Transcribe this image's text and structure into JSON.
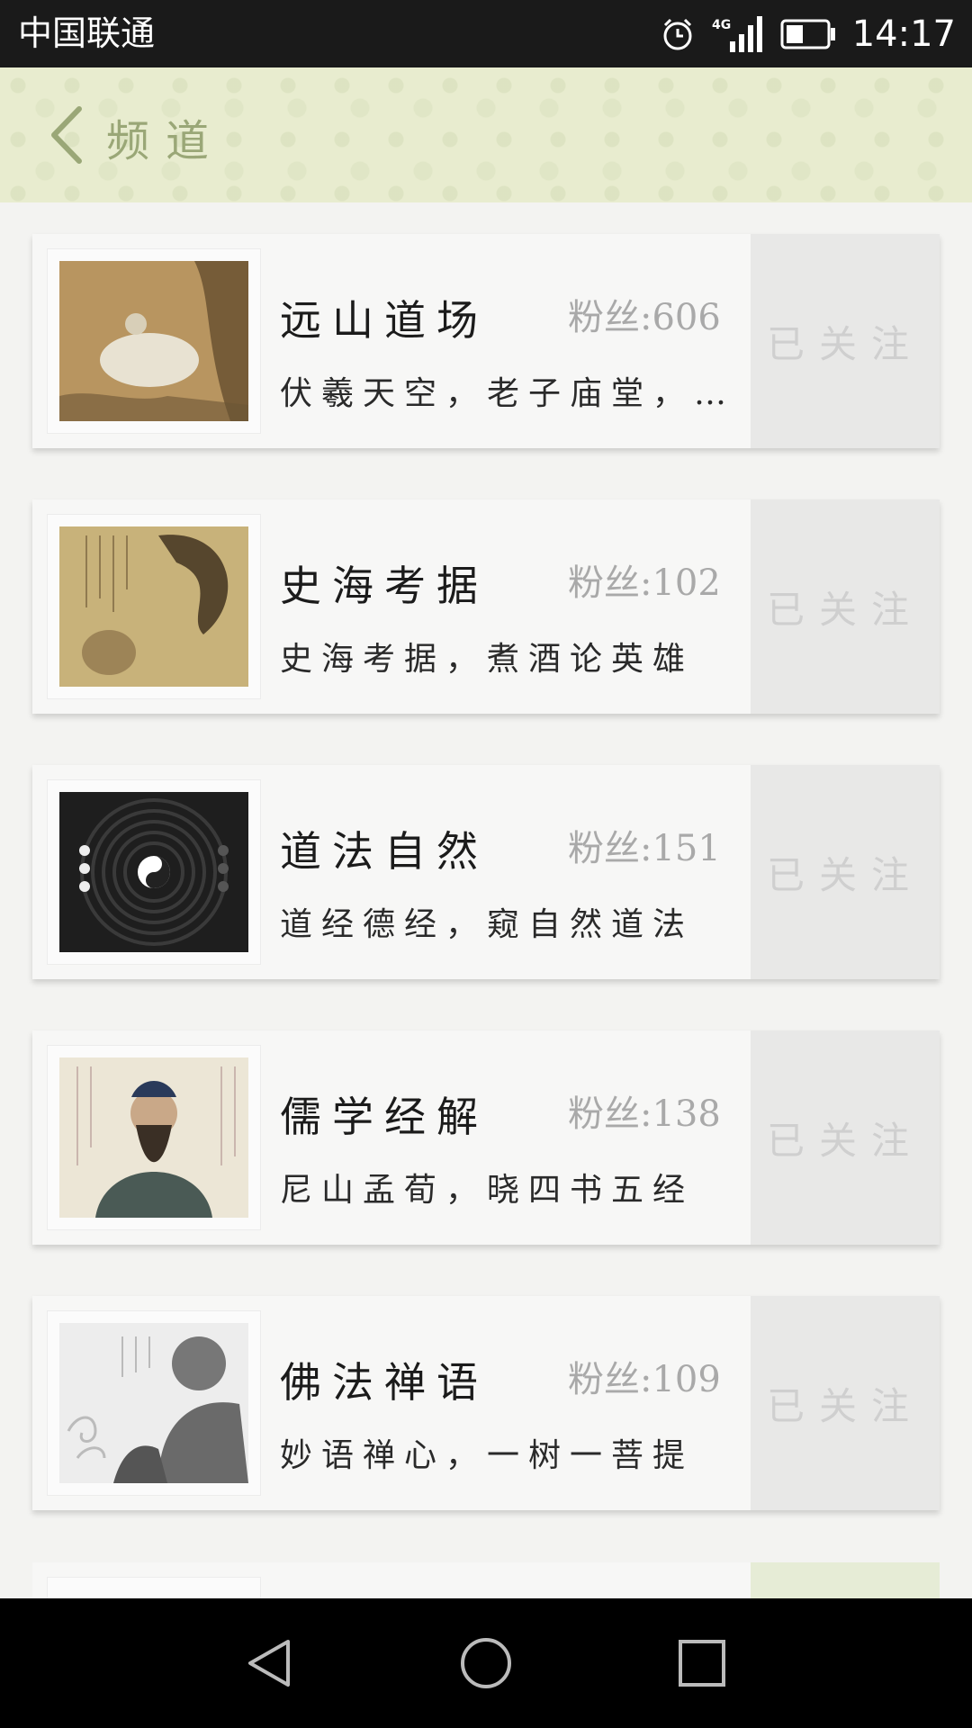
{
  "status_bar": {
    "carrier": "中国联通",
    "time": "14:17",
    "network": "4G"
  },
  "header": {
    "title": "频道"
  },
  "channels": [
    {
      "title": "远山道场",
      "fans": "粉丝:606",
      "desc": "伏羲天空，老子庙堂，…",
      "button": "已关注",
      "thumb": "painting-sage"
    },
    {
      "title": "史海考据",
      "fans": "粉丝:102",
      "desc": "史海考据，煮酒论英雄",
      "button": "已关注",
      "thumb": "painting-scroll"
    },
    {
      "title": "道法自然",
      "fans": "粉丝:151",
      "desc": "道经德经，窥自然道法",
      "button": "已关注",
      "thumb": "yin-yang-zen-garden"
    },
    {
      "title": "儒学经解",
      "fans": "粉丝:138",
      "desc": "尼山孟荀，晓四书五经",
      "button": "已关注",
      "thumb": "confucius-portrait"
    },
    {
      "title": "佛法禅语",
      "fans": "粉丝:109",
      "desc": "妙语禅心，一树一菩提",
      "button": "已关注",
      "thumb": "buddha-statue"
    }
  ],
  "colors": {
    "header_bg": "#e8eccf",
    "title_accent": "#9aa777",
    "follow_text": "#cfcfcf"
  }
}
